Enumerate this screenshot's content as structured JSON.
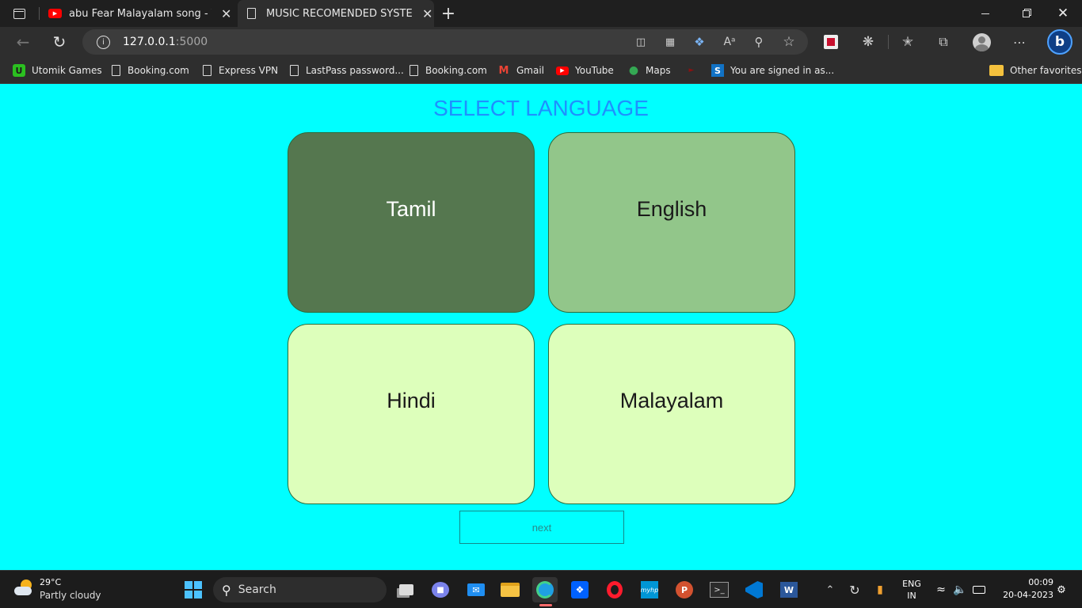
{
  "browser": {
    "tabs": [
      {
        "label": "abu Fear Malayalam song - YouTube",
        "icon": "youtube-icon"
      },
      {
        "label": "MUSIC RECOMENDED SYSTEM",
        "icon": "page-icon"
      }
    ],
    "address": {
      "host": "127.0.0.1",
      "port": ":5000"
    },
    "favorites": [
      {
        "label": "Utomik Games",
        "icon": "utomik-icon"
      },
      {
        "label": "Booking.com",
        "icon": "page-icon"
      },
      {
        "label": "Express VPN",
        "icon": "page-icon"
      },
      {
        "label": "LastPass password...",
        "icon": "page-icon"
      },
      {
        "label": "Booking.com",
        "icon": "page-icon"
      },
      {
        "label": "Gmail",
        "icon": "gmail-icon"
      },
      {
        "label": "YouTube",
        "icon": "youtube-icon"
      },
      {
        "label": "Maps",
        "icon": "maps-icon"
      },
      {
        "label": "",
        "icon": "red-icon"
      },
      {
        "label": "You are signed in as...",
        "icon": "s-icon"
      }
    ],
    "other_favorites": "Other favorites"
  },
  "page": {
    "title": "SELECT LANGUAGE",
    "languages": [
      {
        "label": "Tamil",
        "color": "#55774f",
        "text_color": "#ffffff"
      },
      {
        "label": "English",
        "color": "#92c68a",
        "text_color": "#1a1a1a"
      },
      {
        "label": "Hindi",
        "color": "#ddffbb",
        "text_color": "#1a1a1a"
      },
      {
        "label": "Malayalam",
        "color": "#ddffbb",
        "text_color": "#1a1a1a"
      }
    ],
    "next_label": "next",
    "bg_color": "#00ffff",
    "title_color": "#1e90ff"
  },
  "taskbar": {
    "weather": {
      "temp": "29°C",
      "desc": "Partly cloudy"
    },
    "search": "Search",
    "lang": {
      "line1": "ENG",
      "line2": "IN"
    },
    "clock": {
      "time": "00:09",
      "date": "20-04-2023"
    }
  }
}
